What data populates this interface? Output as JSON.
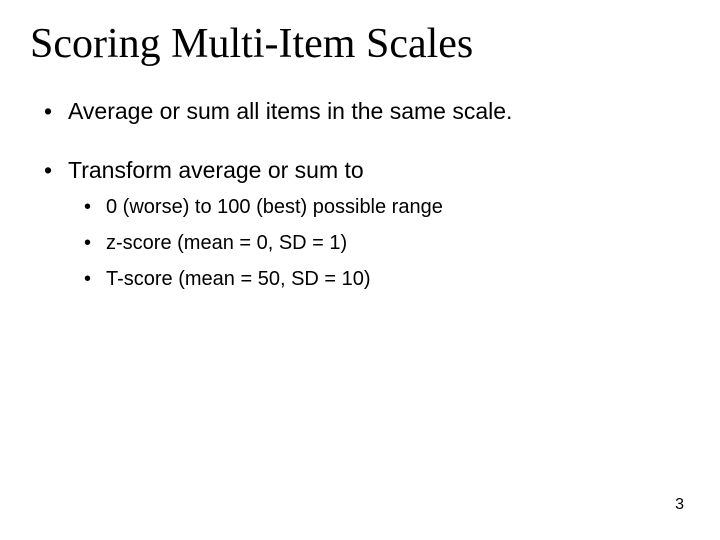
{
  "title": "Scoring Multi-Item Scales",
  "bullets": {
    "b1": "Average or sum all items in the same scale.",
    "b2": "Transform average or sum to",
    "sub": {
      "s1": "0 (worse) to 100 (best) possible range",
      "s2": "z-score (mean =   0, SD =   1)",
      "s3": "T-score (mean = 50, SD = 10)"
    }
  },
  "page_number": "3"
}
